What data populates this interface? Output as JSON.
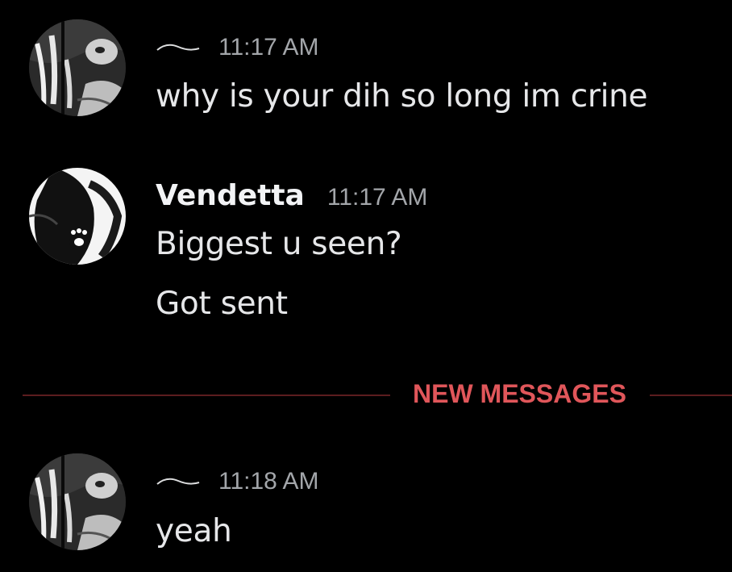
{
  "colors": {
    "background": "#000000",
    "text": "#e6e7e9",
    "username": "#f2f3f5",
    "timestamp": "#a3a6aa",
    "new_messages_accent": "#e0565a",
    "new_messages_line": "#5c1d1f"
  },
  "messages": [
    {
      "author": "",
      "timestamp": "11:17 AM",
      "lines": [
        "why is your dih so long im crine"
      ]
    },
    {
      "author": "Vendetta",
      "timestamp": "11:17 AM",
      "lines": [
        "Biggest u seen?",
        "Got sent"
      ]
    },
    {
      "author": "",
      "timestamp": "11:18 AM",
      "lines": [
        "yeah"
      ]
    }
  ],
  "divider": {
    "label": "NEW MESSAGES"
  }
}
